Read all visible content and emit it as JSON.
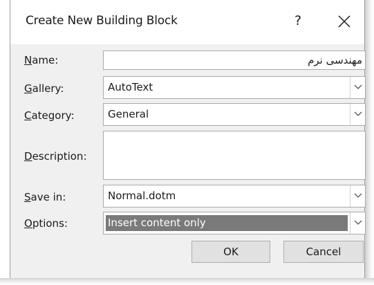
{
  "dialog": {
    "title": "Create New Building Block",
    "help_label": "?"
  },
  "fields": {
    "name": {
      "label_mnemonic": "N",
      "label_rest": "ame:",
      "value": "مهندسی نرم"
    },
    "gallery": {
      "label_mnemonic": "G",
      "label_rest": "allery:",
      "value": "AutoText"
    },
    "category": {
      "label_mnemonic": "C",
      "label_rest": "ategory:",
      "value": "General"
    },
    "description": {
      "label_mnemonic": "D",
      "label_rest": "escription:",
      "value": ""
    },
    "save_in": {
      "label_mnemonic": "S",
      "label_rest": "ave in:",
      "value": "Normal.dotm"
    },
    "options": {
      "label_mnemonic": "O",
      "label_rest": "ptions:",
      "value": "Insert content only"
    }
  },
  "buttons": {
    "ok": "OK",
    "cancel": "Cancel"
  },
  "icons": {
    "close": "close-icon",
    "dropdown": "chevron-down-icon"
  }
}
